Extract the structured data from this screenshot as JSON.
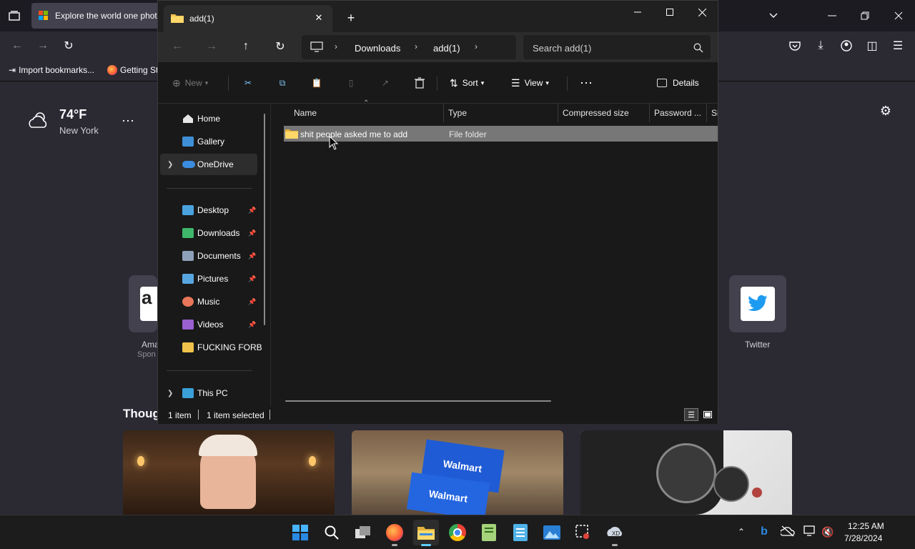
{
  "browser": {
    "tab_title": "Explore the world one photo",
    "bookmarks": [
      "Import bookmarks...",
      "Getting St"
    ],
    "weather": {
      "temp": "74°F",
      "city": "New York"
    },
    "shortcuts": [
      {
        "label": "Ama",
        "sub": "Spon"
      },
      {
        "label": "Twitter"
      }
    ],
    "section_title": "Thoug",
    "photos": [
      {
        "label": "Walmart"
      },
      {
        "label": "Walmart"
      }
    ]
  },
  "explorer": {
    "tab_title": "add(1)",
    "breadcrumb": [
      "Downloads",
      "add(1)"
    ],
    "search_placeholder": "Search add(1)",
    "commands": {
      "new": "New",
      "sort": "Sort",
      "view": "View",
      "details": "Details"
    },
    "nav": {
      "home": "Home",
      "gallery": "Gallery",
      "onedrive": "OneDrive",
      "pinned": [
        {
          "label": "Desktop",
          "color": "#4aa3df"
        },
        {
          "label": "Downloads",
          "color": "#3fb76b"
        },
        {
          "label": "Documents",
          "color": "#8da2b8"
        },
        {
          "label": "Pictures",
          "color": "#58a6e0"
        },
        {
          "label": "Music",
          "color": "#e9765b"
        },
        {
          "label": "Videos",
          "color": "#9a5fd0"
        },
        {
          "label": "FUCKING FORBI",
          "color": "#f0c24b"
        }
      ],
      "this_pc": "This PC"
    },
    "columns": [
      "Name",
      "Type",
      "Compressed size",
      "Password ...",
      "Si"
    ],
    "files": [
      {
        "name": "shit people asked me to add",
        "type": "File folder"
      }
    ],
    "status": {
      "count": "1 item",
      "selected": "1 item selected"
    }
  },
  "taskbar": {
    "time": "12:25 AM",
    "date": "7/28/2024"
  },
  "colors": {
    "accent": "#60cdff",
    "folder": "#f0c24b",
    "selection": "#777777"
  }
}
